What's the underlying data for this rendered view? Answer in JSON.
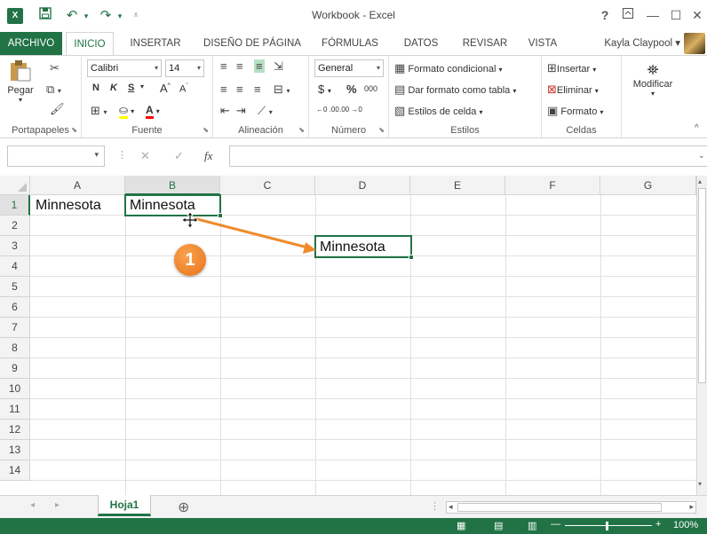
{
  "window": {
    "title": "Workbook - Excel",
    "help": "?",
    "restore_ribbon": "⊼",
    "minimize": "—",
    "maximize": "☐",
    "close": "✕"
  },
  "quick_access": {
    "save_icon": "save-icon",
    "undo_icon": "undo-icon",
    "redo_icon": "redo-icon"
  },
  "tabs": {
    "file": "ARCHIVO",
    "items": [
      "INICIO",
      "INSERTAR",
      "DISEÑO DE PÁGINA",
      "FÓRMULAS",
      "DATOS",
      "REVISAR",
      "VISTA"
    ],
    "active": "INICIO"
  },
  "user": {
    "name": "Kayla Claypool"
  },
  "ribbon": {
    "clipboard": {
      "label": "Portapapeles",
      "paste": "Pegar"
    },
    "font": {
      "label": "Fuente",
      "name": "Calibri",
      "size": "14",
      "bold": "N",
      "italic": "K",
      "underline": "S",
      "grow": "A",
      "shrink": "A"
    },
    "alignment": {
      "label": "Alineación"
    },
    "number": {
      "label": "Número",
      "format": "General",
      "currency": "$",
      "percent": "%",
      "thousands": "000",
      "inc_decimal": "←0 .00",
      "dec_decimal": ".00 →0"
    },
    "styles": {
      "label": "Estilos",
      "conditional": "Formato condicional",
      "table": "Dar formato como tabla",
      "cell_styles": "Estilos de celda"
    },
    "cells": {
      "label": "Celdas",
      "insert": "Insertar",
      "delete": "Eliminar",
      "format": "Formato"
    },
    "editing": {
      "modify": "Modificar"
    }
  },
  "formula_bar": {
    "name_box": "",
    "fx": "fx",
    "cancel": "✕",
    "enter": "✓",
    "content": ""
  },
  "grid": {
    "columns": [
      "A",
      "B",
      "C",
      "D",
      "E",
      "F",
      "G"
    ],
    "rows": [
      "1",
      "2",
      "3",
      "4",
      "5",
      "6",
      "7",
      "8",
      "9",
      "10",
      "11",
      "12",
      "13",
      "14"
    ],
    "cells": {
      "A1": "Minnesota",
      "B1": "Minnesota",
      "D3": "Minnesota"
    }
  },
  "sheets": {
    "active": "Hoja1",
    "add": "⊕"
  },
  "status": {
    "zoom": "100%"
  },
  "annotation": {
    "step": "1"
  },
  "colors": {
    "excel_green": "#217346",
    "callout_orange": "#f08a2c"
  }
}
